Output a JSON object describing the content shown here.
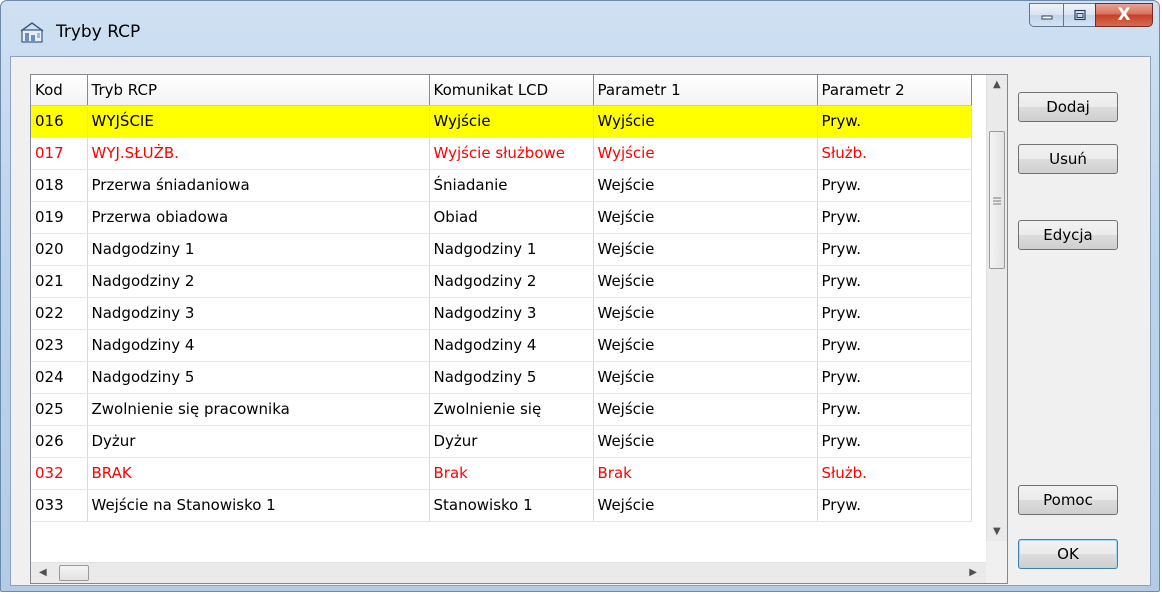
{
  "window": {
    "title": "Tryby RCP",
    "caption_close_glyph": "X",
    "icons": [
      "app-icon",
      "minimize-icon",
      "maximize-icon",
      "close-icon"
    ]
  },
  "table": {
    "columns": [
      "Kod",
      "Tryb RCP",
      "Komunikat LCD",
      "Parametr 1",
      "Parametr 2"
    ],
    "rows": [
      [
        "016",
        "WYJŚCIE",
        "Wyjście",
        "Wyjście",
        "Pryw."
      ],
      [
        "017",
        "WYJ.SŁUŻB.",
        "Wyjście służbowe",
        "Wyjście",
        "Służb."
      ],
      [
        "018",
        "Przerwa śniadaniowa",
        "Śniadanie",
        "Wejście",
        "Pryw."
      ],
      [
        "019",
        "Przerwa obiadowa",
        "Obiad",
        "Wejście",
        "Pryw."
      ],
      [
        "020",
        "Nadgodziny 1",
        "Nadgodziny 1",
        "Wejście",
        "Pryw."
      ],
      [
        "021",
        "Nadgodziny 2",
        "Nadgodziny 2",
        "Wejście",
        "Pryw."
      ],
      [
        "022",
        "Nadgodziny 3",
        "Nadgodziny 3",
        "Wejście",
        "Pryw."
      ],
      [
        "023",
        "Nadgodziny 4",
        "Nadgodziny 4",
        "Wejście",
        "Pryw."
      ],
      [
        "024",
        "Nadgodziny 5",
        "Nadgodziny 5",
        "Wejście",
        "Pryw."
      ],
      [
        "025",
        "Zwolnienie się pracownika",
        "Zwolnienie się",
        "Wejście",
        "Pryw."
      ],
      [
        "026",
        "Dyżur",
        "Dyżur",
        "Wejście",
        "Pryw."
      ],
      [
        "032",
        "BRAK",
        "Brak",
        "Brak",
        "Służb."
      ],
      [
        "033",
        "Wejście na Stanowisko 1",
        "Stanowisko 1",
        "Wejście",
        "Pryw."
      ]
    ],
    "selected_row_code": "016",
    "red_row_codes": [
      "017",
      "032"
    ],
    "colors": {
      "selected_bg": "#ffff00",
      "red_text": "#ff0000"
    }
  },
  "buttons": {
    "add": "Dodaj",
    "remove": "Usuń",
    "edit": "Edycja",
    "help": "Pomoc",
    "ok": "OK"
  }
}
